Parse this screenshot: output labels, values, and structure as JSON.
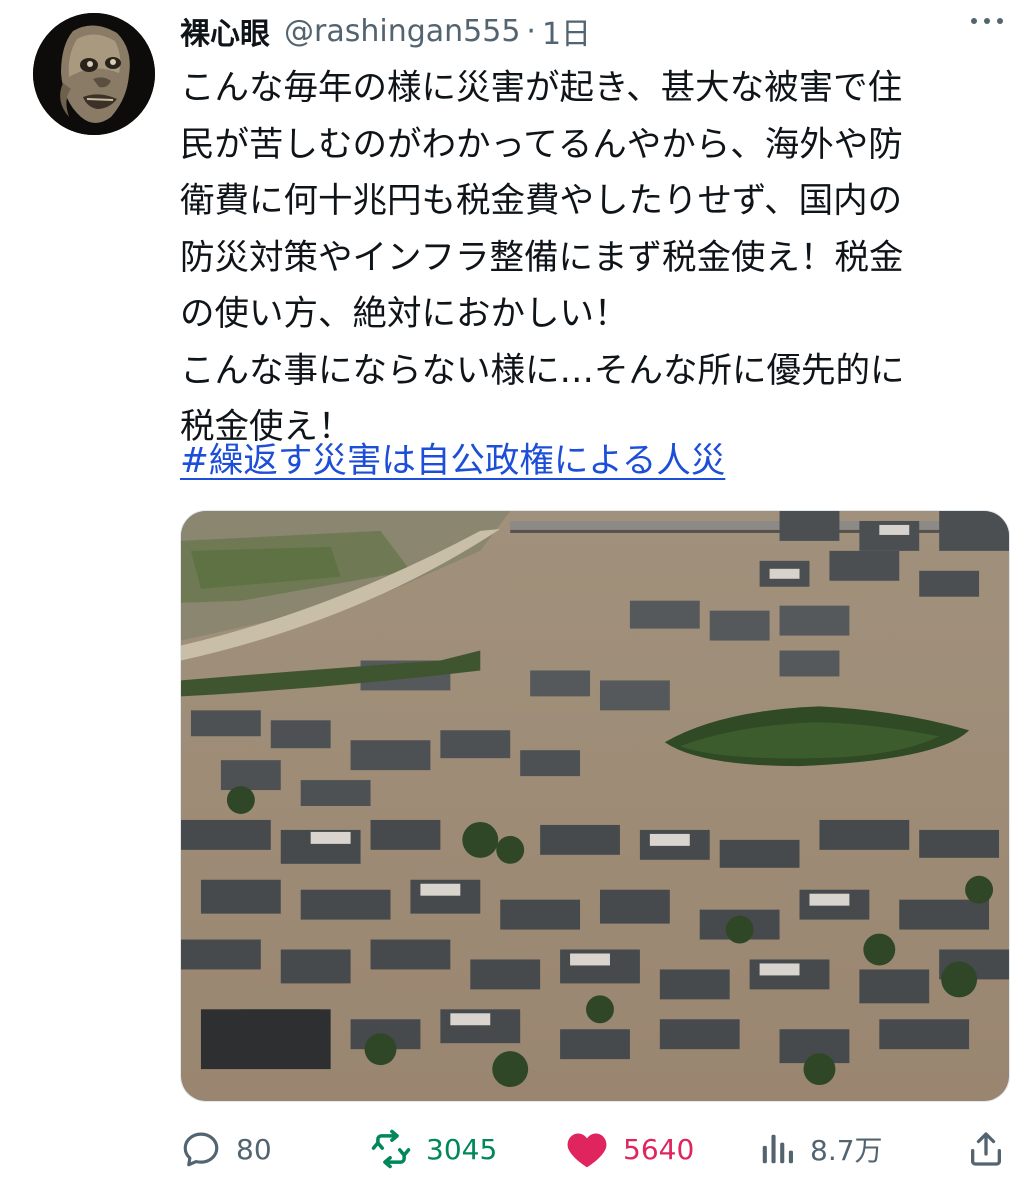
{
  "user": {
    "display_name": "裸心眼",
    "handle": "@rashingan555",
    "separator": "·",
    "time": "1日"
  },
  "tweet": {
    "lines": [
      "こんな毎年の様に災害が起き、甚大な被害で住",
      "民が苦しむのがわかってるんやから、海外や防",
      "衛費に何十兆円も税金費やしたりせず、国内の",
      "防災対策やインフラ整備にまず税金使え！税金",
      "の使い方、絶対におかしい！",
      "こんな事にならない様に…そんな所に優先的に",
      "税金使え！"
    ],
    "hashtag": "#繰返す災害は自公政権による人災"
  },
  "actions": {
    "replies": "80",
    "retweets": "3045",
    "likes": "5640",
    "views": "8.7万"
  },
  "colors": {
    "text": "#0f1419",
    "secondary": "#536471",
    "link": "#1d4ed8",
    "retweet": "#00875a",
    "like": "#e0245e"
  },
  "icons": {
    "more": "more-icon",
    "reply": "reply-icon",
    "retweet": "retweet-icon",
    "like": "heart-icon",
    "views": "views-icon",
    "share": "share-icon"
  }
}
